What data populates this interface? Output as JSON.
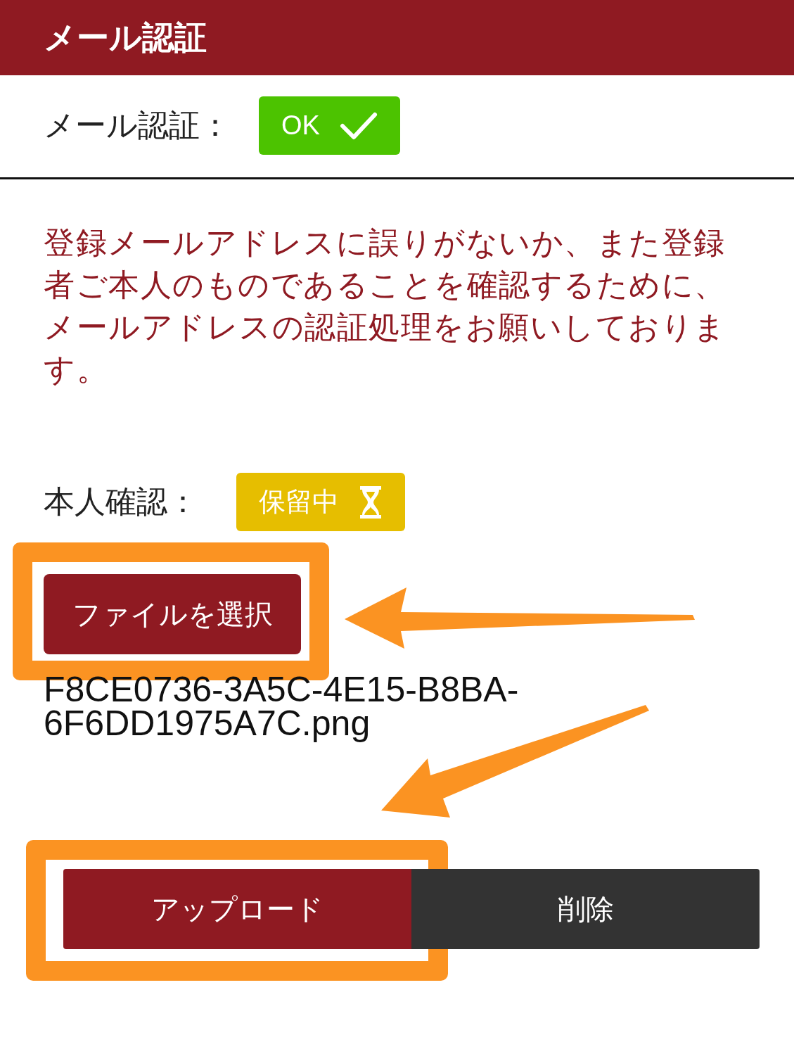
{
  "header": {
    "title": "メール認証"
  },
  "email_verification": {
    "label": "メール認証：",
    "kind": "ok",
    "status_text": "OK"
  },
  "notice": "登録メールアドレスに誤りがないか、また登録者ご本人のものであることを確認するために、メールアドレスの認証処理をお願いしております。",
  "identity_verification": {
    "label": "本人確認：",
    "kind": "pending",
    "status_text": "保留中"
  },
  "file_button": "ファイルを選択",
  "filename": "F8CE0736-3A5C-4E15-B8BA-6F6DD1975A7C.png",
  "buttons": [
    {
      "label": "アップロード",
      "kind": "upload"
    },
    {
      "label": "削除",
      "kind": "delete"
    }
  ]
}
